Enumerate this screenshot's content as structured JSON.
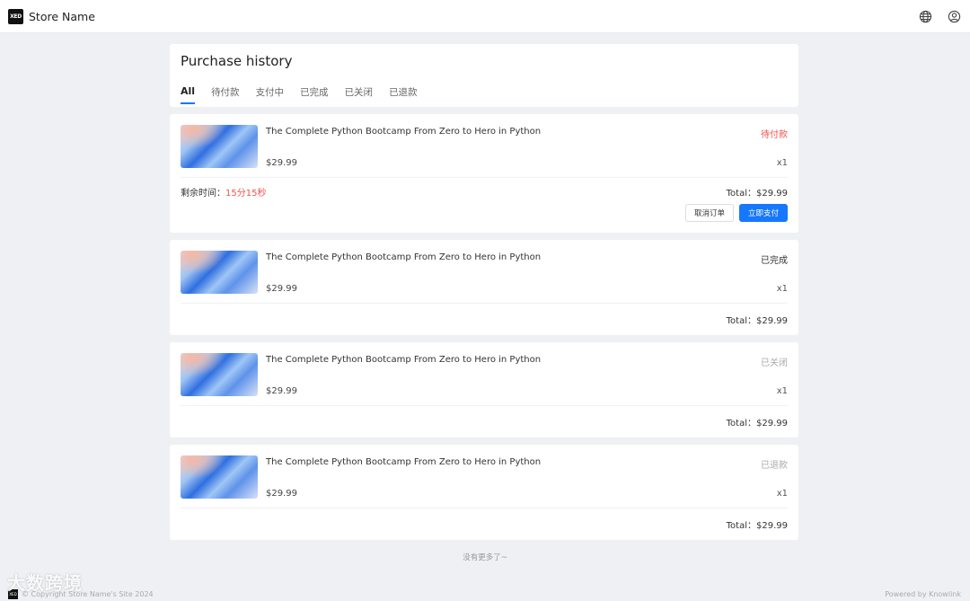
{
  "header": {
    "logo_text": "XED",
    "store_name": "Store Name",
    "icons": [
      "globe-icon",
      "user-circle-icon"
    ]
  },
  "page": {
    "title": "Purchase history",
    "tabs": [
      {
        "label": "All",
        "active": true
      },
      {
        "label": "待付款",
        "active": false
      },
      {
        "label": "支付中",
        "active": false
      },
      {
        "label": "已完成",
        "active": false
      },
      {
        "label": "已关闭",
        "active": false
      },
      {
        "label": "已退款",
        "active": false
      }
    ]
  },
  "orders": [
    {
      "title": "The Complete Python Bootcamp From Zero to Hero in Python",
      "price": "$29.99",
      "status": "待付款",
      "qty": "x1",
      "total": "Total：$29.99",
      "countdown_label": "剩余时间：",
      "countdown_value": "15分15秒",
      "cancel_label": "取消订单",
      "pay_label": "立即支付"
    },
    {
      "title": "The Complete Python Bootcamp From Zero to Hero in Python",
      "price": "$29.99",
      "status": "已完成",
      "qty": "x1",
      "total": "Total：$29.99"
    },
    {
      "title": "The Complete Python Bootcamp From Zero to Hero in Python",
      "price": "$29.99",
      "status": "已关闭",
      "qty": "x1",
      "total": "Total：$29.99"
    },
    {
      "title": "The Complete Python Bootcamp From Zero to Hero in Python",
      "price": "$29.99",
      "status": "已退款",
      "qty": "x1",
      "total": "Total：$29.99"
    }
  ],
  "no_more": "没有更多了~",
  "footer": {
    "copyright": "© Copyright Store Name's Site 2024",
    "powered": "Powered by Knowlink",
    "watermark": "大数跨境"
  },
  "colors": {
    "accent": "#1677ff",
    "pending": "#ef5350",
    "muted": "#aaaaaa",
    "background": "#eef0f4"
  }
}
